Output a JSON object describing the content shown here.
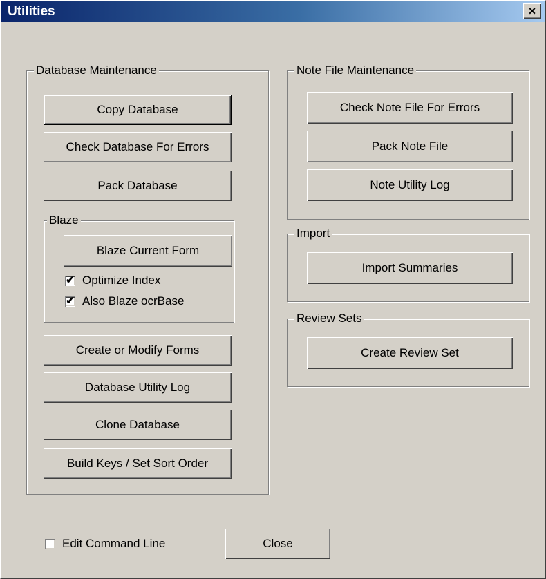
{
  "window": {
    "title": "Utilities",
    "close_glyph": "×"
  },
  "database_maintenance": {
    "label": "Database Maintenance",
    "copy_database": "Copy Database",
    "check_database": "Check Database For Errors",
    "pack_database": "Pack Database",
    "blaze": {
      "label": "Blaze",
      "blaze_current_form": "Blaze Current Form",
      "optimize_index": {
        "label": "Optimize Index",
        "checked": true
      },
      "also_blaze_ocrbase": {
        "label": "Also Blaze ocrBase",
        "checked": true
      }
    },
    "create_or_modify_forms": "Create or Modify Forms",
    "database_utility_log": "Database Utility Log",
    "clone_database": "Clone Database",
    "build_keys": "Build Keys / Set Sort Order"
  },
  "note_file_maintenance": {
    "label": "Note File Maintenance",
    "check_note_file": "Check Note File For Errors",
    "pack_note_file": "Pack Note File",
    "note_utility_log": "Note Utility Log"
  },
  "import": {
    "label": "Import",
    "import_summaries": "Import Summaries"
  },
  "review_sets": {
    "label": "Review Sets",
    "create_review_set": "Create Review Set"
  },
  "footer": {
    "edit_command_line": {
      "label": "Edit Command Line",
      "checked": false
    },
    "close_label": "Close"
  },
  "checkmark_glyph": "✔",
  "colors": {
    "face": "#d4d0c8",
    "title_start": "#0a246a",
    "title_end": "#a6caf0"
  }
}
